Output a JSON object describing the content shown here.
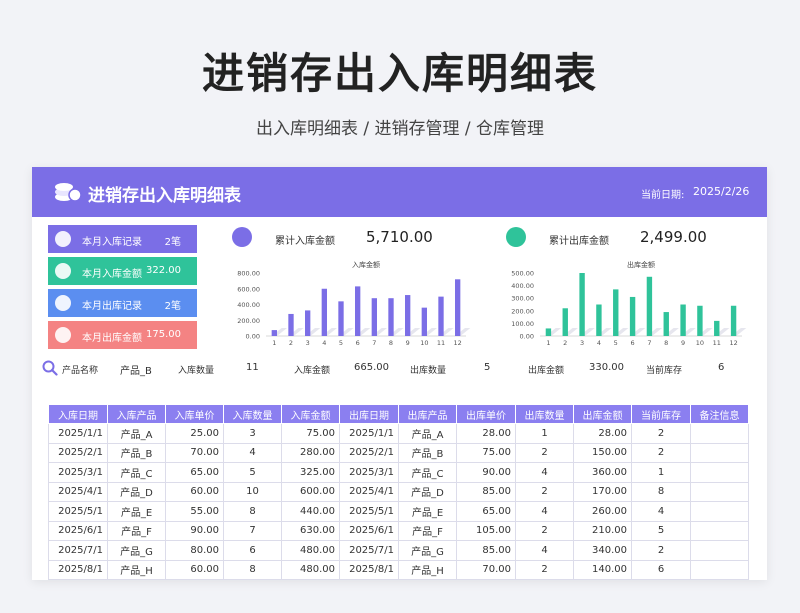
{
  "hero": {
    "title": "进销存出入库明细表",
    "subtitle": "出入库明细表 / 进销存管理 / 仓库管理"
  },
  "banner": {
    "title": "进销存出入库明细表",
    "date_label": "当前日期:",
    "date_value": "2025/2/26"
  },
  "colors": {
    "banner": "#7b6ee6",
    "in_bar": "#7b6ee6",
    "out_bar": "#2fc39a",
    "card_purple": "#7b6ee6",
    "card_green": "#2fc39a",
    "card_blue": "#5b8ef0",
    "card_red": "#f48383",
    "header": "#8b7ff0"
  },
  "side_cards": [
    {
      "label": "本月入库记录",
      "value": "2笔",
      "icon": "chart-icon"
    },
    {
      "label": "本月入库金额",
      "value": "322.00",
      "icon": "coin-icon"
    },
    {
      "label": "本月出库记录",
      "value": "2笔",
      "icon": "chart-icon"
    },
    {
      "label": "本月出库金额",
      "value": "175.00",
      "icon": "coin-icon"
    }
  ],
  "kpis": {
    "in_total_label": "累计入库金额",
    "in_total_value": "5,710.00",
    "out_total_label": "累计出库金额",
    "out_total_value": "2,499.00"
  },
  "chart_data": [
    {
      "type": "bar",
      "title": "入库金额",
      "categories": [
        "1",
        "2",
        "3",
        "4",
        "5",
        "6",
        "7",
        "8",
        "9",
        "10",
        "11",
        "12"
      ],
      "values": [
        75,
        280,
        325,
        600,
        440,
        630,
        480,
        480,
        520,
        360,
        500,
        720
      ],
      "ylim": [
        0,
        800
      ],
      "yticks": [
        "0.00",
        "200.00",
        "400.00",
        "600.00",
        "800.00"
      ],
      "ytick_values": [
        0,
        200,
        400,
        600,
        800
      ],
      "grid": false
    },
    {
      "type": "bar",
      "title": "出库金额",
      "categories": [
        "1",
        "2",
        "3",
        "4",
        "5",
        "6",
        "7",
        "8",
        "9",
        "10",
        "11",
        "12"
      ],
      "values": [
        60,
        220,
        500,
        250,
        370,
        310,
        470,
        190,
        250,
        240,
        120,
        240
      ],
      "ylim": [
        0,
        500
      ],
      "yticks": [
        "0.00",
        "100.00",
        "200.00",
        "300.00",
        "400.00",
        "500.00"
      ],
      "ytick_values": [
        0,
        100,
        200,
        300,
        400,
        500
      ],
      "grid": false
    }
  ],
  "filter": {
    "product_label": "产品名称",
    "product_value": "产品_B",
    "in_qty_label": "入库数量",
    "in_qty_value": "11",
    "in_amt_label": "入库金额",
    "in_amt_value": "665.00",
    "out_qty_label": "出库数量",
    "out_qty_value": "5",
    "out_amt_label": "出库金额",
    "out_amt_value": "330.00",
    "stock_label": "当前库存",
    "stock_value": "6"
  },
  "table": {
    "headers": [
      "入库日期",
      "入库产品",
      "入库单价",
      "入库数量",
      "入库金额",
      "出库日期",
      "出库产品",
      "出库单价",
      "出库数量",
      "出库金额",
      "当前库存",
      "备注信息"
    ],
    "rows": [
      [
        "2025/1/1",
        "产品_A",
        "25.00",
        "3",
        "75.00",
        "2025/1/1",
        "产品_A",
        "28.00",
        "1",
        "28.00",
        "2",
        ""
      ],
      [
        "2025/2/1",
        "产品_B",
        "70.00",
        "4",
        "280.00",
        "2025/2/1",
        "产品_B",
        "75.00",
        "2",
        "150.00",
        "2",
        ""
      ],
      [
        "2025/3/1",
        "产品_C",
        "65.00",
        "5",
        "325.00",
        "2025/3/1",
        "产品_C",
        "90.00",
        "4",
        "360.00",
        "1",
        ""
      ],
      [
        "2025/4/1",
        "产品_D",
        "60.00",
        "10",
        "600.00",
        "2025/4/1",
        "产品_D",
        "85.00",
        "2",
        "170.00",
        "8",
        ""
      ],
      [
        "2025/5/1",
        "产品_E",
        "55.00",
        "8",
        "440.00",
        "2025/5/1",
        "产品_E",
        "65.00",
        "4",
        "260.00",
        "4",
        ""
      ],
      [
        "2025/6/1",
        "产品_F",
        "90.00",
        "7",
        "630.00",
        "2025/6/1",
        "产品_F",
        "105.00",
        "2",
        "210.00",
        "5",
        ""
      ],
      [
        "2025/7/1",
        "产品_G",
        "80.00",
        "6",
        "480.00",
        "2025/7/1",
        "产品_G",
        "85.00",
        "4",
        "340.00",
        "2",
        ""
      ],
      [
        "2025/8/1",
        "产品_H",
        "60.00",
        "8",
        "480.00",
        "2025/8/1",
        "产品_H",
        "70.00",
        "2",
        "140.00",
        "6",
        ""
      ]
    ]
  }
}
